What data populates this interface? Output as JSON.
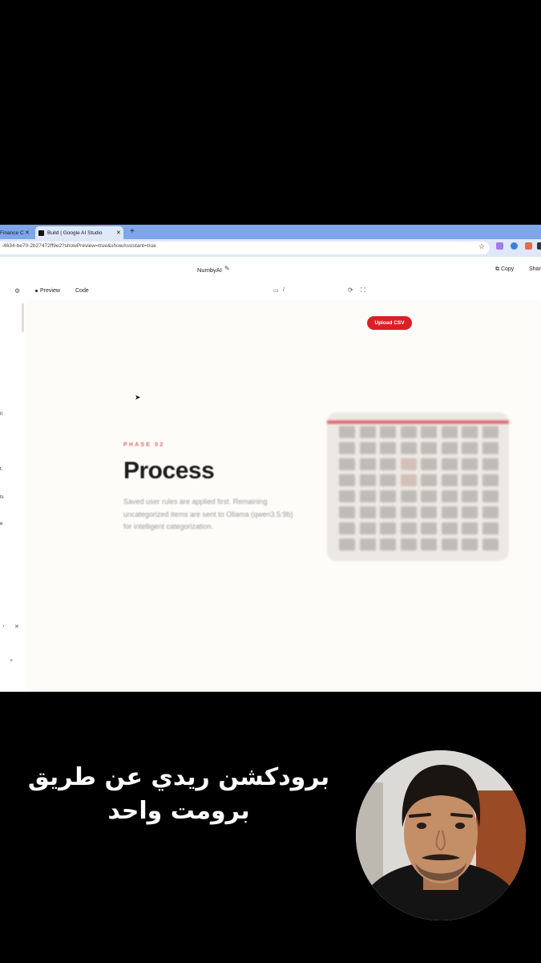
{
  "browser": {
    "tabs": [
      {
        "label": "Finance C",
        "active": false
      },
      {
        "label": "Build | Google AI Studio",
        "active": true
      }
    ],
    "new_tab_icon": "plus-icon",
    "url": "-4634-be70-2b27472ff9e2?showPreview=true&showAssistant=true"
  },
  "app": {
    "name": "NumbyAI",
    "copy_label": "Copy",
    "share_label": "Shar"
  },
  "toolbar": {
    "preview_label": "Preview",
    "code_label": "Code",
    "path_slash": "/"
  },
  "left_panel": {
    "fragments": [
      "n",
      "t.",
      "ts",
      "e"
    ]
  },
  "preview": {
    "upload_label": "Upload CSV",
    "phase_label": "PHASE 02",
    "title": "Process",
    "description": "Saved user rules are applied first. Remaining uncategorized items are sent to Ollama (qwen3.5:9b) for intelligent categorization.",
    "accent_color": "#dc1f26"
  },
  "video_overlay": {
    "subtitle_line1": "برودكشن ريدي عن طريق",
    "subtitle_line2": "برومت واحد"
  }
}
